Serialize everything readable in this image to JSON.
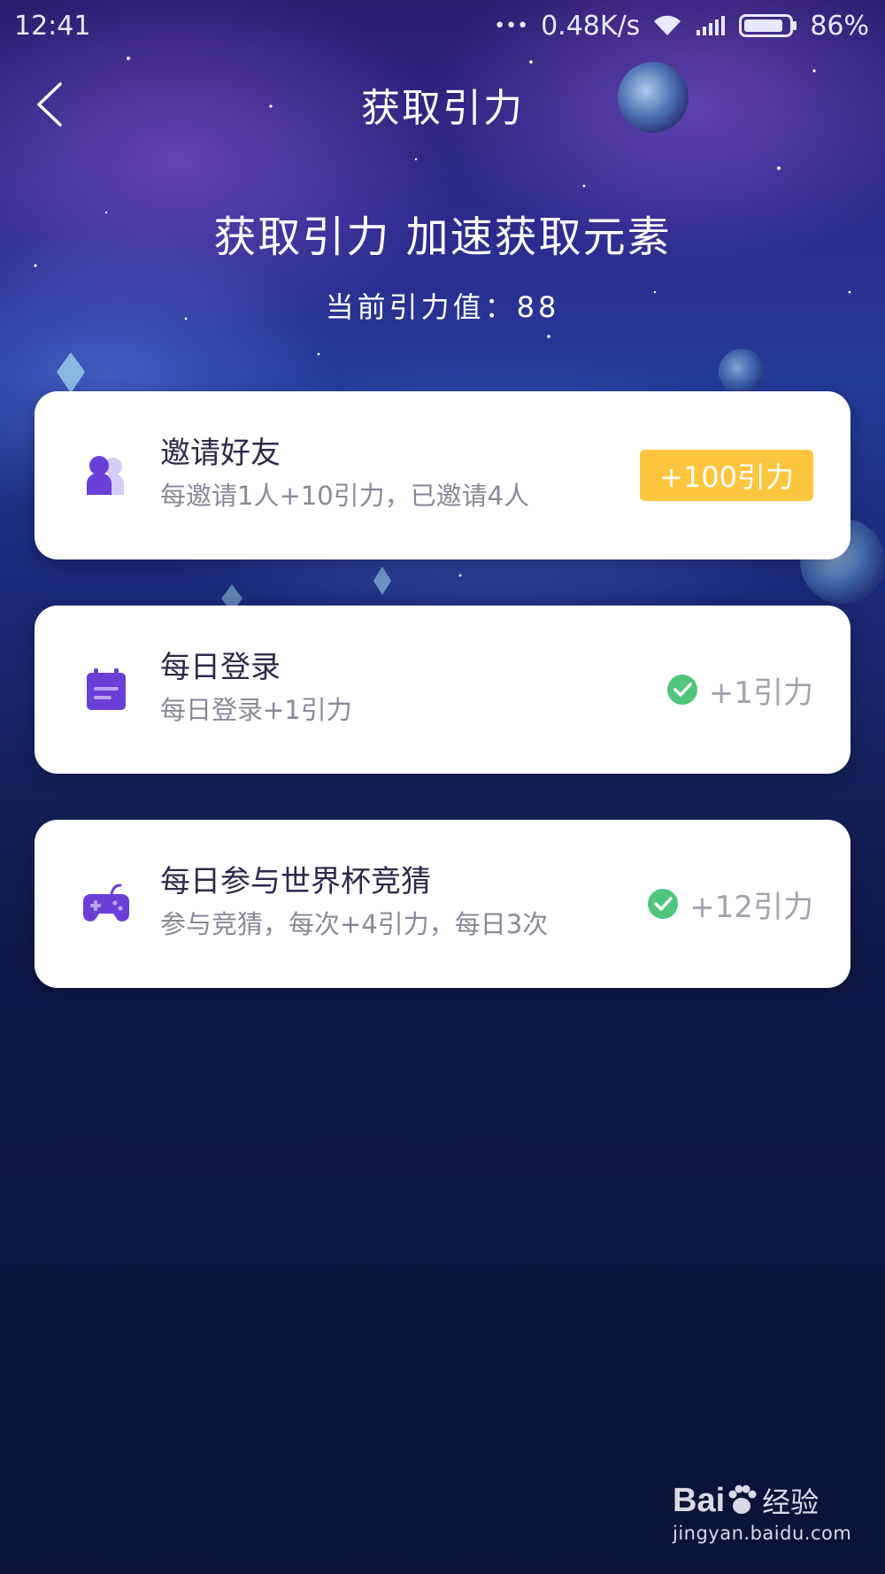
{
  "status_bar": {
    "time": "12:41",
    "dots": "•••",
    "network_speed": "0.48K/s",
    "battery": "86%",
    "battery_level": 0.86
  },
  "nav": {
    "title": "获取引力",
    "back_icon": "chevron-left-icon"
  },
  "hero": {
    "title": "获取引力 加速获取元素",
    "subtitle": "当前引力值：88"
  },
  "tasks": [
    {
      "title": "邀请好友",
      "description": "每邀请1人+10引力，已邀请4人",
      "reward": "+100引力",
      "icon": "users-icon",
      "completed": false
    },
    {
      "title": "每日登录",
      "description": "每日登录+1引力",
      "reward": "+1引力",
      "icon": "calendar-icon",
      "completed": true
    },
    {
      "title": "每日参与世界杯竞猜",
      "description": "参与竞猜，每次+4引力，每日3次",
      "reward": "+12引力",
      "icon": "gamepad-icon",
      "completed": true
    }
  ],
  "watermark": {
    "logo_text": "Bai",
    "logo_suffix": "经验",
    "url": "jingyan.baidu.com"
  },
  "colors": {
    "accent_purple": "#6a3fd8",
    "reward_yellow": "#fec63e",
    "check_green": "#4fc67c"
  }
}
